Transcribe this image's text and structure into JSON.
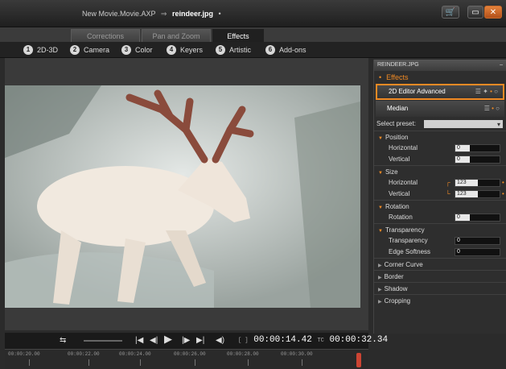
{
  "titlebar": {
    "project": "New Movie.Movie.AXP",
    "separator": "⇒",
    "file": "reindeer.jpg",
    "marker": "•"
  },
  "window_controls": {
    "cart": "🛒",
    "maximize": "▭",
    "close": "✕"
  },
  "tabs": [
    {
      "label": "Corrections",
      "active": false
    },
    {
      "label": "Pan and Zoom",
      "active": false
    },
    {
      "label": "Effects",
      "active": true
    }
  ],
  "categories": [
    {
      "num": "1",
      "label": "2D-3D"
    },
    {
      "num": "2",
      "label": "Camera"
    },
    {
      "num": "3",
      "label": "Color"
    },
    {
      "num": "4",
      "label": "Keyers"
    },
    {
      "num": "5",
      "label": "Artistic"
    },
    {
      "num": "6",
      "label": "Add-ons"
    }
  ],
  "transport": {
    "loop": "⇆",
    "prev": "|◀",
    "rewind": "◀|",
    "play": "▶",
    "step": "|▶",
    "next": "▶|",
    "volume": "◀)",
    "in_marker": "[ ]",
    "current_time": "00:00:14.42",
    "tc_label": "TC",
    "total_time": "00:00:32.34"
  },
  "ruler_ticks": [
    "00:00:20.00",
    "00:00:22.00",
    "00:00:24.00",
    "00:00:26.00",
    "00:00:28.00",
    "00:00:30.00"
  ],
  "panel": {
    "title": "REINDEER.JPG",
    "minimize": "–",
    "effects_label": "Effects",
    "effects": [
      {
        "name": "2D Editor Advanced",
        "selected": true,
        "controls": "☰ ✦"
      },
      {
        "name": "Median",
        "selected": false,
        "controls": "☰"
      }
    ],
    "preset_label": "Select preset:",
    "preset_value": "",
    "groups": [
      {
        "name": "Position",
        "open": true,
        "params": [
          {
            "label": "Horizontal",
            "value": "0"
          },
          {
            "label": "Vertical",
            "value": "0"
          }
        ]
      },
      {
        "name": "Size",
        "open": true,
        "params": [
          {
            "label": "Horizontal",
            "value": "123"
          },
          {
            "label": "Vertical",
            "value": "123"
          }
        ]
      },
      {
        "name": "Rotation",
        "open": true,
        "params": [
          {
            "label": "Rotation",
            "value": "0"
          }
        ]
      },
      {
        "name": "Transparency",
        "open": true,
        "params": [
          {
            "label": "Transparency",
            "value": "0"
          },
          {
            "label": "Edge Softness",
            "value": "0"
          }
        ]
      },
      {
        "name": "Corner Curve",
        "open": false
      },
      {
        "name": "Border",
        "open": false
      },
      {
        "name": "Shadow",
        "open": false
      },
      {
        "name": "Cropping",
        "open": false
      }
    ]
  },
  "colors": {
    "accent": "#f08a24",
    "background": "#2b2b2b",
    "panel": "#2e2e2e"
  }
}
